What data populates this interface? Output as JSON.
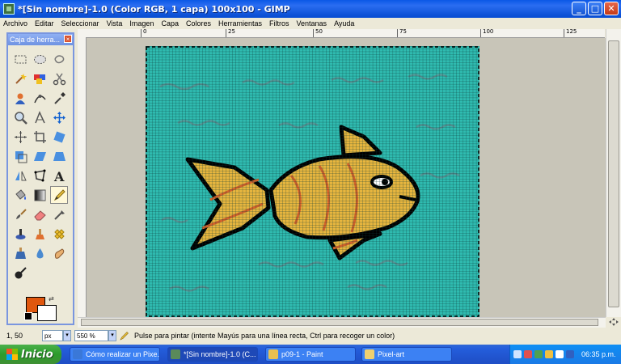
{
  "window": {
    "title": "*[Sin nombre]-1.0 (Color RGB, 1 capa) 100x100 - GIMP",
    "minimize": "_",
    "maximize": "□",
    "close": "✕"
  },
  "menu": [
    "Archivo",
    "Editar",
    "Seleccionar",
    "Vista",
    "Imagen",
    "Capa",
    "Colores",
    "Herramientas",
    "Filtros",
    "Ventanas",
    "Ayuda"
  ],
  "ruler": {
    "labels": [
      "0",
      "25",
      "50",
      "75",
      "100",
      "125"
    ]
  },
  "toolbox": {
    "title": "Caja de herra...",
    "close": "×",
    "tools": [
      "rect-select-icon",
      "ellipse-select-icon",
      "free-select-icon",
      "fuzzy-select-icon",
      "color-select-icon",
      "scissors-icon",
      "foreground-select-icon",
      "paths-icon",
      "color-picker-icon",
      "zoom-icon",
      "measure-icon",
      "move-icon",
      "align-icon",
      "crop-icon",
      "rotate-icon",
      "scale-icon",
      "shear-icon",
      "perspective-icon",
      "flip-icon",
      "cage-icon",
      "text-icon",
      "bucket-fill-icon",
      "blend-icon",
      "pencil-icon",
      "paintbrush-icon",
      "eraser-icon",
      "airbrush-icon",
      "ink-icon",
      "clone-icon",
      "heal-icon",
      "perspective-clone-icon",
      "blur-icon",
      "smudge-icon",
      "dodge-burn-icon"
    ],
    "active_tool": "pencil-icon",
    "fg_color": "#e0570e",
    "bg_color": "#ffffff"
  },
  "status": {
    "coords": "1, 50",
    "unit": "px",
    "zoom": "550 %",
    "message": "Pulse para pintar (intente Mayús para una línea recta, Ctrl para recoger un color)"
  },
  "taskbar": {
    "start": "Inicio",
    "buttons": [
      {
        "label": "Cómo realizar un Pixe...",
        "icon_color": "#3a78d8"
      },
      {
        "label": "*[Sin nombre]-1.0 (C...",
        "icon_color": "#5a8a5a"
      },
      {
        "label": "p09-1 - Paint",
        "icon_color": "#e8c050"
      },
      {
        "label": "Pixel-art",
        "icon_color": "#f0d070"
      }
    ],
    "clock": "06:35 p.m."
  },
  "canvas": {
    "grid_cells": 100,
    "background": "#2fbbb0",
    "fish_body": "#e8b63e",
    "fish_stripe": "#d4622a",
    "outline": "#000000"
  }
}
